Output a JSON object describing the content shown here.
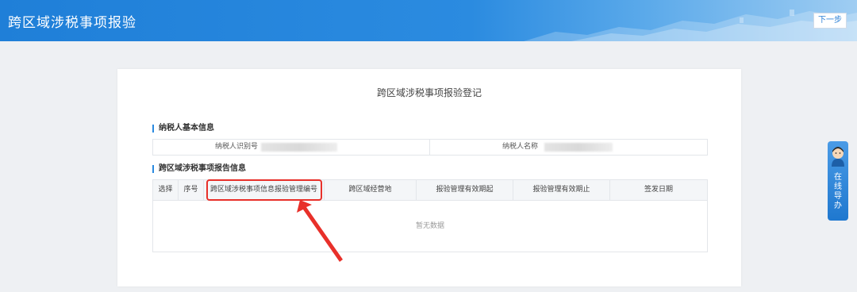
{
  "header": {
    "title": "跨区域涉税事项报验",
    "next_label": "下一步"
  },
  "form": {
    "title": "跨区域涉税事项报验登记",
    "basic_section_title": "纳税人基本信息",
    "taxpayer_id_label": "纳税人识别号",
    "taxpayer_name_label": "纳税人名称",
    "report_section_title": "跨区域涉税事项报告信息"
  },
  "table": {
    "columns": [
      "选择",
      "序号",
      "跨区域涉税事项信息报验管理编号",
      "跨区域经营地",
      "报验管理有效期起",
      "报验管理有效期止",
      "签发日期"
    ],
    "empty_text": "暂无数据"
  },
  "online_service": {
    "label": "在线导办"
  },
  "colors": {
    "accent": "#2a8ae0",
    "highlight": "#e8302a"
  }
}
